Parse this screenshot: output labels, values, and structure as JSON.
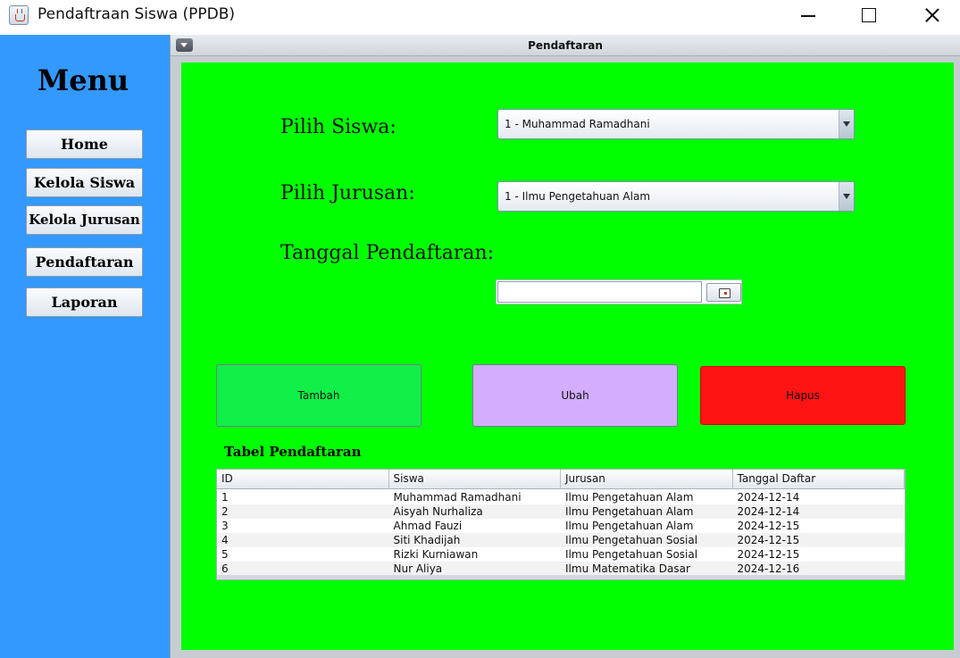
{
  "window": {
    "title": "Pendaftraan Siswa (PPDB)",
    "icon": "java-cup-icon",
    "controls": [
      "minimize-icon",
      "maximize-icon",
      "close-icon"
    ]
  },
  "sidebar": {
    "title": "Menu",
    "background": "#3399ff",
    "items": [
      {
        "label": "Home"
      },
      {
        "label": "Kelola Siswa"
      },
      {
        "label": "Kelola Jurusan"
      },
      {
        "label": "Pendaftaran"
      },
      {
        "label": "Laporan"
      }
    ]
  },
  "frame": {
    "title": "Pendaftaran",
    "background": "#00ff00"
  },
  "form": {
    "siswa_label": "Pilih Siswa:",
    "siswa_value": "1 - Muhammad Ramadhani",
    "jurusan_label": "Pilih Jurusan:",
    "jurusan_value": "1 - Ilmu Pengetahuan Alam",
    "tanggal_label": "Tanggal Pendaftaran:",
    "tanggal_value": "",
    "calendar_icon": "calendar-icon"
  },
  "actions": {
    "tambah": {
      "label": "Tambah",
      "color": "#11ef49"
    },
    "ubah": {
      "label": "Ubah",
      "color": "#d3aeff"
    },
    "hapus": {
      "label": "Hapus",
      "color": "#ff1414"
    }
  },
  "table": {
    "title": "Tabel Pendaftaran",
    "headers": [
      "ID",
      "Siswa",
      "Jurusan",
      "Tanggal Daftar"
    ],
    "rows": [
      [
        "1",
        "Muhammad Ramadhani",
        "Ilmu Pengetahuan Alam",
        "2024-12-14"
      ],
      [
        "2",
        "Aisyah Nurhaliza",
        "Ilmu Pengetahuan Alam",
        "2024-12-14"
      ],
      [
        "3",
        "Ahmad Fauzi",
        "Ilmu Pengetahuan Alam",
        "2024-12-15"
      ],
      [
        "4",
        "Siti Khadijah",
        "Ilmu Pengetahuan Sosial",
        "2024-12-15"
      ],
      [
        "5",
        "Rizki Kurniawan",
        "Ilmu Pengetahuan Sosial",
        "2024-12-15"
      ],
      [
        "6",
        "Nur Aliya",
        "Ilmu Matematika Dasar",
        "2024-12-16"
      ]
    ]
  }
}
